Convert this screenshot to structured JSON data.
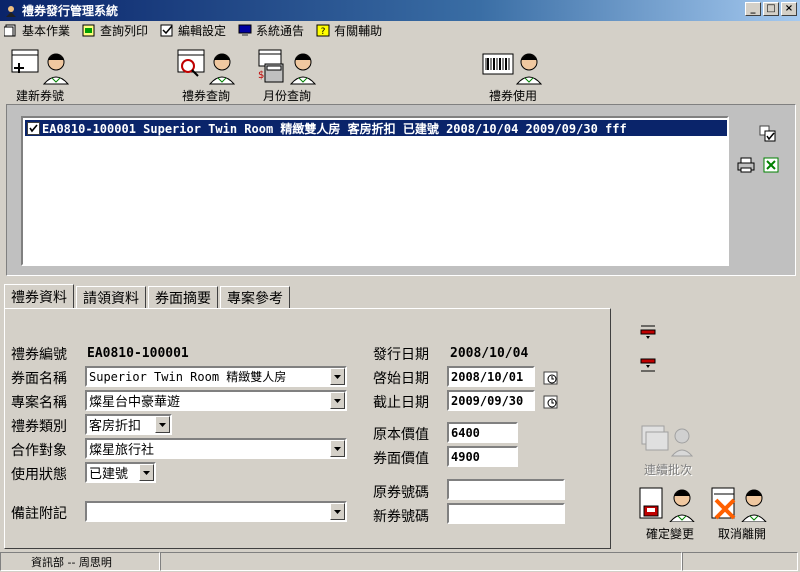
{
  "window": {
    "title": "禮券發行管理系統",
    "min": "_",
    "max": "□",
    "close": "×"
  },
  "menu": [
    {
      "label": "基本作業",
      "icon": "document-icon"
    },
    {
      "label": "查詢列印",
      "icon": "print-query-icon"
    },
    {
      "label": "編輯設定",
      "icon": "edit-settings-icon"
    },
    {
      "label": "系統通告",
      "icon": "monitor-icon"
    },
    {
      "label": "有關輔助",
      "icon": "help-icon"
    }
  ],
  "toolbar": {
    "new_voucher": "建新券號",
    "voucher_query": "禮券查詢",
    "monthly_query": "月份查詢",
    "voucher_use": "禮券使用"
  },
  "list": {
    "rows": [
      {
        "checked": true,
        "text": "EA0810-100001 Superior Twin Room 精緻雙人房 客房折扣 已建號  2008/10/04 2009/09/30 fff"
      }
    ]
  },
  "tabs": [
    "禮券資料",
    "請領資料",
    "券面摘要",
    "專案參考"
  ],
  "form": {
    "voucher_no_label": "禮券編號",
    "voucher_no": "EA0810-100001",
    "face_name_label": "券面名稱",
    "face_name": "Superior Twin Room 精緻雙人房",
    "project_label": "專案名稱",
    "project": "燦星台中豪華遊",
    "category_label": "禮券類別",
    "category": "客房折扣",
    "partner_label": "合作對象",
    "partner": "燦星旅行社",
    "status_label": "使用狀態",
    "status": "已建號",
    "remark_label": "備註附記",
    "remark": "",
    "issue_date_label": "發行日期",
    "issue_date": "2008/10/04",
    "start_date_label": "啓始日期",
    "start_date": "2008/10/01",
    "end_date_label": "截止日期",
    "end_date": "2009/09/30",
    "orig_price_label": "原本價值",
    "orig_price": "6400",
    "face_price_label": "券面價值",
    "face_price": "4900",
    "orig_no_label": "原券號碼",
    "orig_no": "",
    "new_no_label": "新券號碼",
    "new_no": ""
  },
  "actions": {
    "batch": "連續批次",
    "confirm": "確定變更",
    "cancel": "取消離開"
  },
  "status": {
    "user": "資訊部 -- 周思明"
  }
}
